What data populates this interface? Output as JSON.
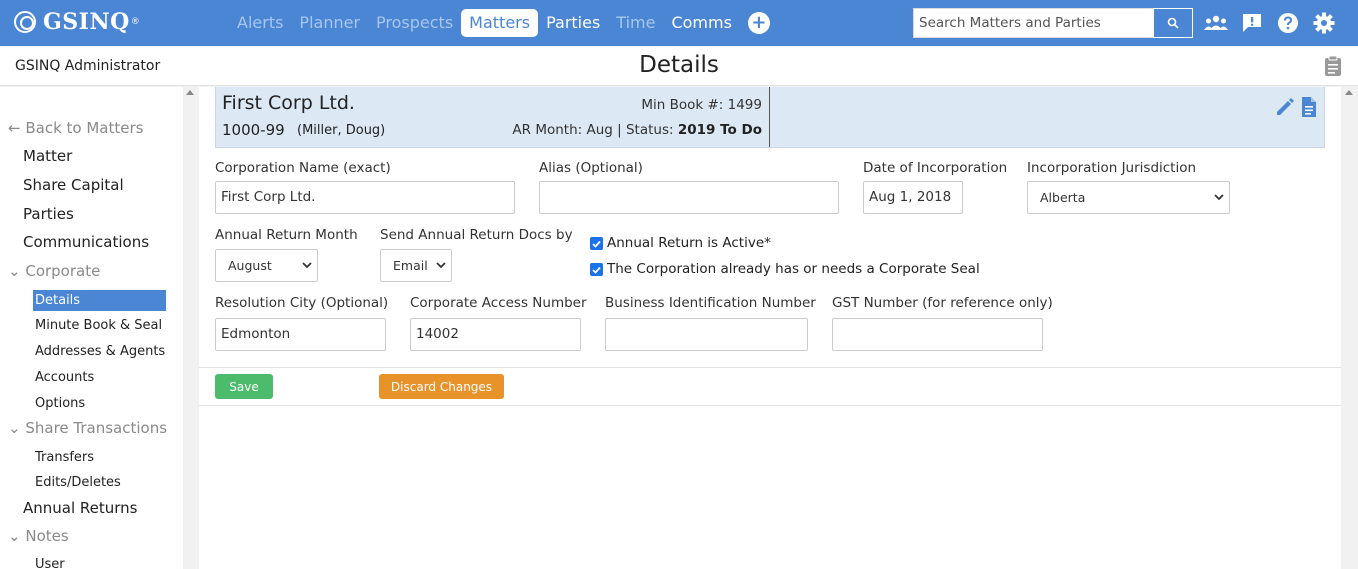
{
  "topbar": {
    "logo_text": "GSINQ",
    "logo_reg": "®",
    "nav": [
      {
        "label": "Alerts",
        "state": "dim"
      },
      {
        "label": "Planner",
        "state": "dim"
      },
      {
        "label": "Prospects",
        "state": "dim"
      },
      {
        "label": "Matters",
        "state": "active"
      },
      {
        "label": "Parties",
        "state": "white"
      },
      {
        "label": "Time",
        "state": "dim"
      },
      {
        "label": "Comms",
        "state": "white"
      }
    ],
    "search_placeholder": "Search Matters and Parties"
  },
  "subheader": {
    "admin": "GSINQ Administrator",
    "title": "Details"
  },
  "sidebar": {
    "back": "Back to Matters",
    "items": {
      "matter": "Matter",
      "share_capital": "Share Capital",
      "parties": "Parties",
      "communications": "Communications",
      "corporate": "Corporate",
      "details": "Details",
      "minute_book": "Minute Book & Seal",
      "addresses": "Addresses & Agents",
      "accounts": "Accounts",
      "options": "Options",
      "share_transactions": "Share Transactions",
      "transfers": "Transfers",
      "edits": "Edits/Deletes",
      "annual_returns": "Annual Returns",
      "notes": "Notes",
      "user": "User"
    }
  },
  "card": {
    "corp_name": "First Corp Ltd.",
    "matter_number": "1000-99",
    "client": "(Miller, Doug)",
    "min_book": "Min Book #: 1499",
    "ar_month_prefix": "AR Month: Aug | Status: ",
    "status": "2019 To Do"
  },
  "form": {
    "corp_name_label": "Corporation Name (exact)",
    "corp_name_value": "First Corp Ltd.",
    "alias_label": "Alias (Optional)",
    "alias_value": "",
    "doi_label": "Date of Incorporation",
    "doi_value": "Aug 1, 2018",
    "jurisdiction_label": "Incorporation Jurisdiction",
    "jurisdiction_value": "Alberta",
    "ar_month_label": "Annual Return Month",
    "ar_month_value": "August",
    "send_docs_label": "Send Annual Return Docs by",
    "send_docs_value": "Email",
    "ar_active_label": "Annual Return is Active*",
    "seal_label": "The Corporation already has or needs a Corporate Seal",
    "res_city_label": "Resolution City (Optional)",
    "res_city_value": "Edmonton",
    "can_label": "Corporate Access Number",
    "can_value": "14002",
    "bin_label": "Business Identification Number",
    "bin_value": "",
    "gst_label": "GST Number (for reference only)",
    "gst_value": ""
  },
  "buttons": {
    "save": "Save",
    "discard": "Discard Changes"
  },
  "colors": {
    "brand": "#4a86d4",
    "save": "#4cbb6c",
    "discard": "#e8922a",
    "card_bg": "#dde8f5"
  }
}
